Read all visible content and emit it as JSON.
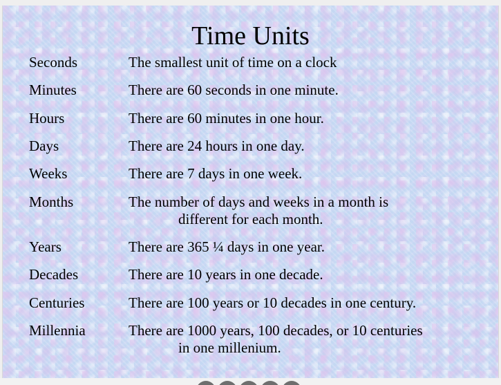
{
  "title": "Time Units",
  "units": [
    {
      "term": "Seconds",
      "definition": [
        "The smallest unit of time on a clock"
      ]
    },
    {
      "term": "Minutes",
      "definition": [
        "There are 60 seconds in one minute."
      ]
    },
    {
      "term": "Hours",
      "definition": [
        "There are 60 minutes in one hour."
      ]
    },
    {
      "term": "Days",
      "definition": [
        "There are 24 hours in one day."
      ]
    },
    {
      "term": "Weeks",
      "definition": [
        "There are 7 days in one week."
      ]
    },
    {
      "term": "Months",
      "definition": [
        "The number of days and weeks in a month is",
        "different for each month."
      ]
    },
    {
      "term": "Years",
      "definition": [
        "There are 365 ¼ days in one year."
      ]
    },
    {
      "term": "Decades",
      "definition": [
        "There are 10 years in one decade."
      ]
    },
    {
      "term": "Centuries",
      "definition": [
        "There are 100 years or 10 decades in one century."
      ]
    },
    {
      "term": "Millennia",
      "definition": [
        "There are 1000 years, 100 decades, or 10 centuries",
        "in one millenium."
      ]
    }
  ],
  "colors": {
    "slide_background": "#c9dcf4",
    "text": "#000000"
  }
}
